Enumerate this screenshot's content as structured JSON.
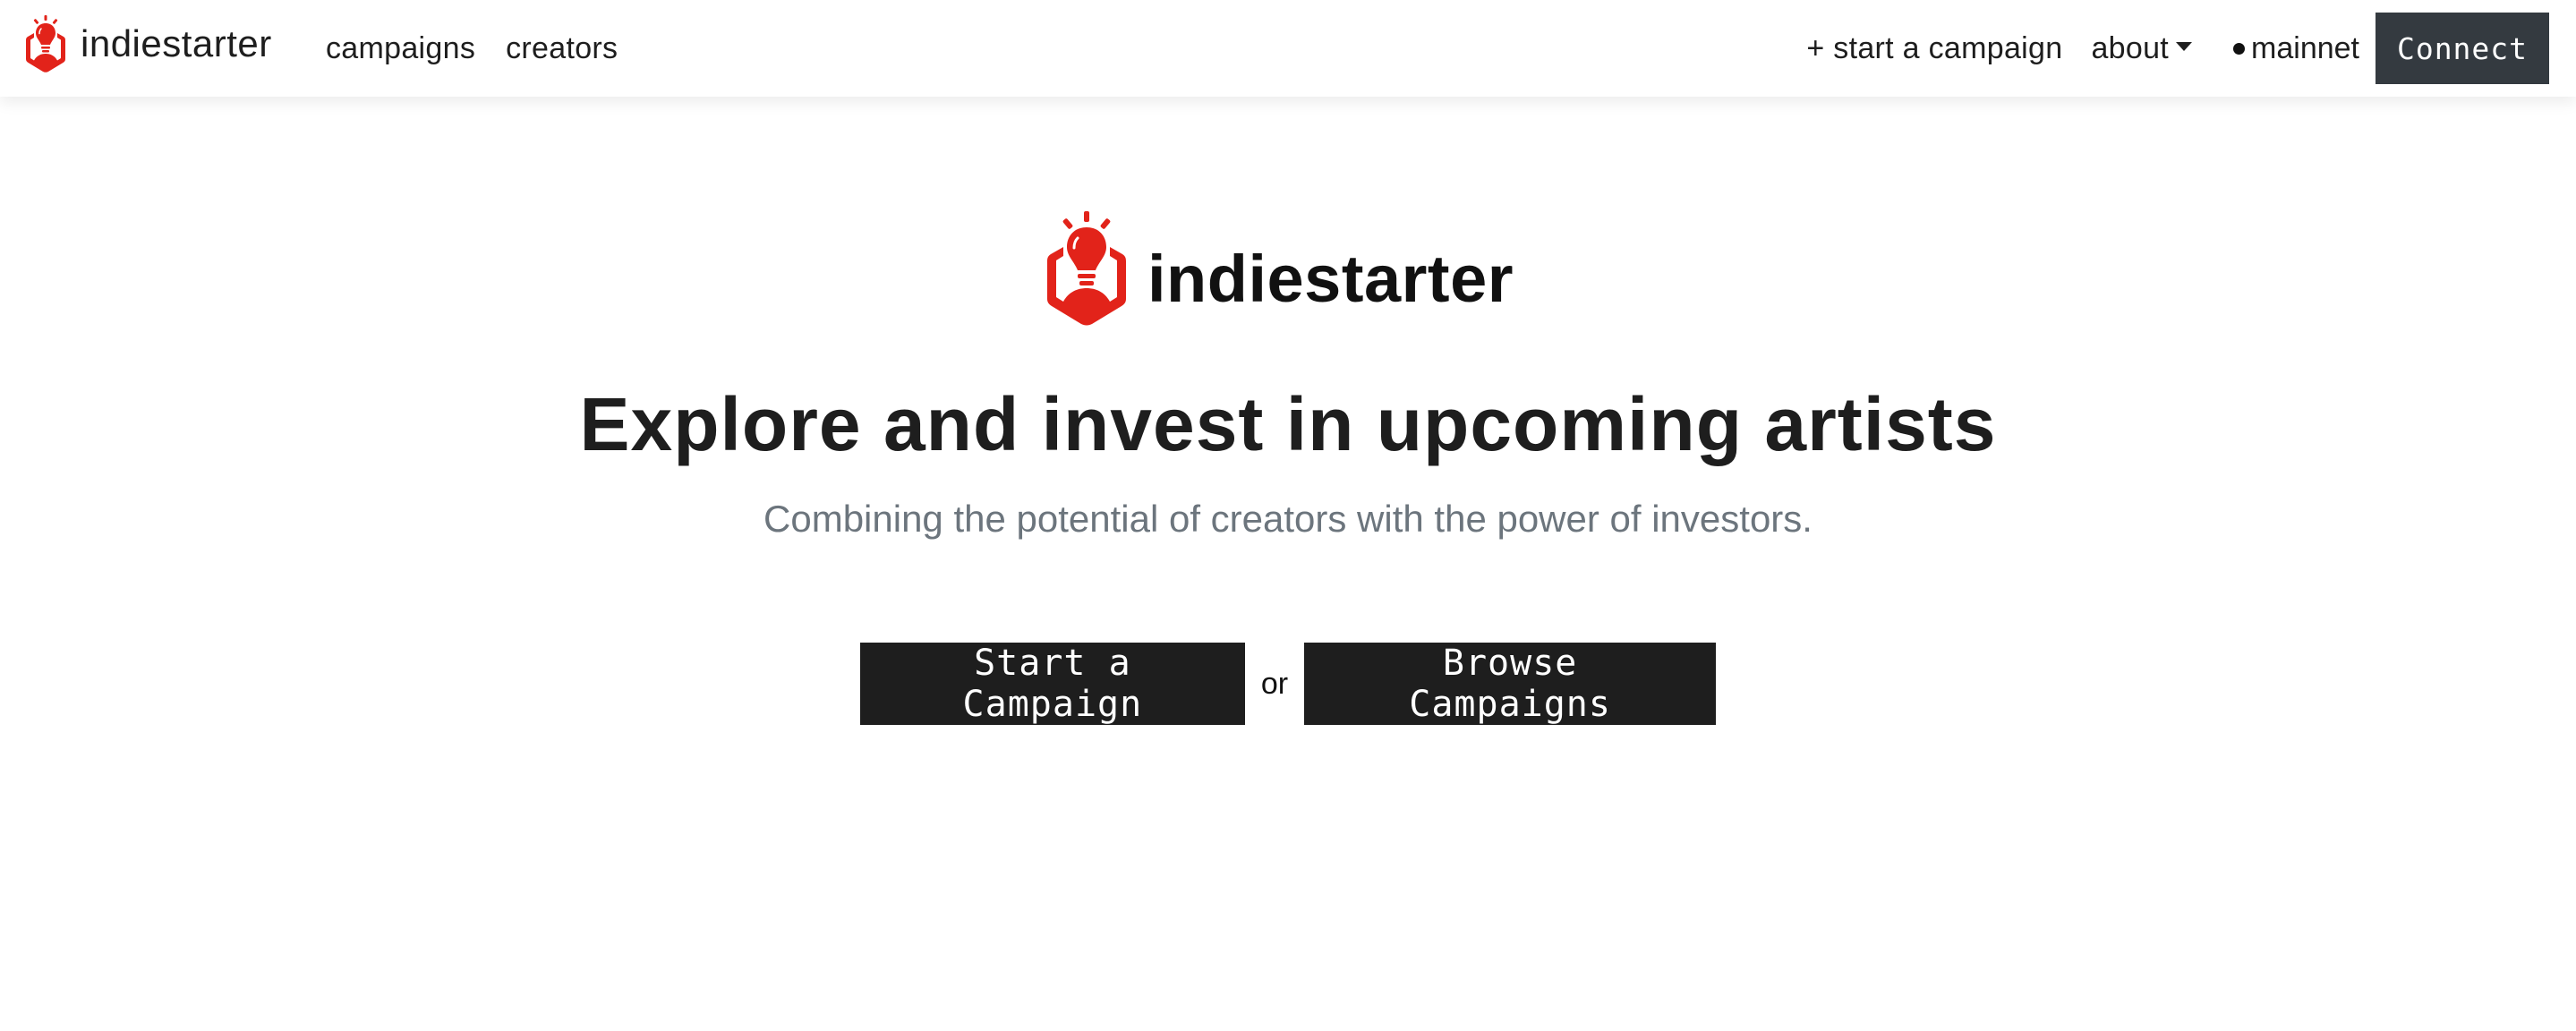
{
  "navbar": {
    "brand": {
      "icon": "lightbulb-hexagon-logo",
      "name": "indiestarter"
    },
    "links_left": [
      {
        "label": "campaigns"
      },
      {
        "label": "creators"
      }
    ],
    "start_campaign_label": "+ start a campaign",
    "about_label": "about",
    "about_icon": "caret-down-icon",
    "network": {
      "indicator_icon": "dot-icon",
      "label": "mainnet"
    },
    "connect_label": "Connect"
  },
  "hero": {
    "logo_name": "indiestarter",
    "headline": "Explore and invest in upcoming artists",
    "subtitle": "Combining the potential of creators with the power of investors.",
    "primary_button": "Start a Campaign",
    "separator": "or",
    "secondary_button": "Browse Campaigns"
  },
  "colors": {
    "brand_red": "#e2231a",
    "text_dark": "#1e1e1e",
    "text_muted": "#6c757d",
    "connect_bg": "#343a40",
    "cta_bg": "#1e1e1e",
    "background": "#ffffff"
  }
}
